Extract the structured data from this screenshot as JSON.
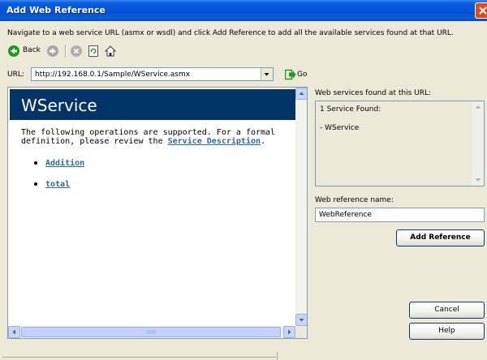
{
  "window": {
    "title": "Add Web Reference"
  },
  "instruction": "Navigate to a web service URL (asmx or wsdl) and click Add Reference to add all the available services found at that URL.",
  "toolbar": {
    "back_label": "Back",
    "icons": [
      "back-arrow-icon",
      "forward-arrow-icon",
      "stop-icon",
      "refresh-icon",
      "home-icon"
    ]
  },
  "url": {
    "label": "URL:",
    "value": "http://192.168.0.1/Sample/WService.asmx",
    "go_label": "Go"
  },
  "service_page": {
    "title": "WService",
    "description_prefix": "The following operations are supported. For a formal definition, please review the ",
    "description_link": "Service Description",
    "description_suffix": ".",
    "operations": [
      "Addition",
      "total"
    ]
  },
  "services_found": {
    "label": "Web services found at this URL:",
    "count_text": "1 Service Found:",
    "items": [
      "- WService"
    ]
  },
  "reference": {
    "label": "Web reference name:",
    "value": "WebReference",
    "add_button": "Add Reference"
  },
  "buttons": {
    "cancel": "Cancel",
    "help": "Help"
  },
  "colors": {
    "titlebar": "#0350d8",
    "banner": "#003366",
    "link": "#336699",
    "go_arrow": "#1c9a1c"
  }
}
